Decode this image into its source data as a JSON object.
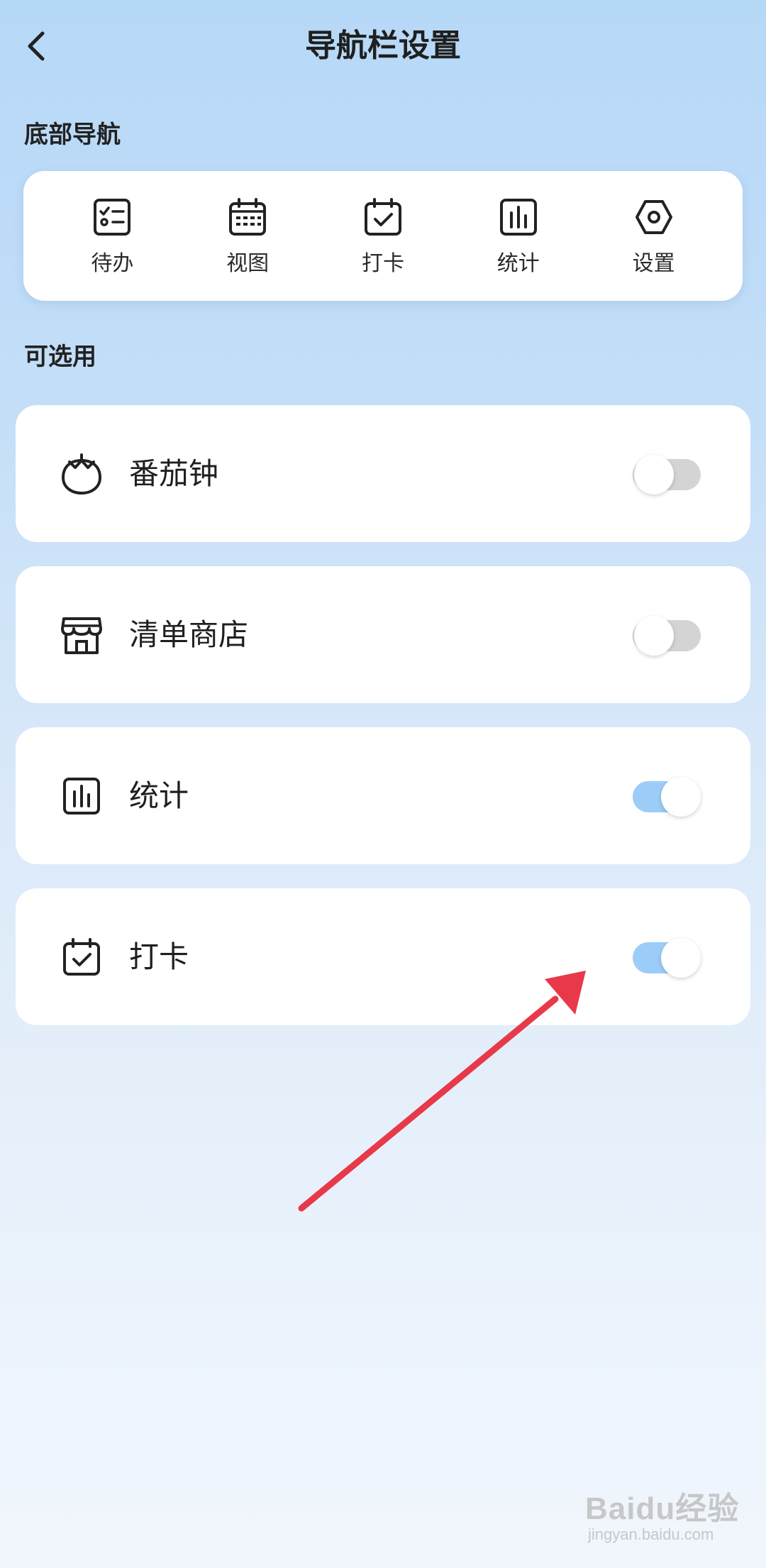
{
  "header": {
    "title": "导航栏设置",
    "back_icon": "chevron-left-icon"
  },
  "bottom_nav": {
    "section_label": "底部导航",
    "items": [
      {
        "label": "待办",
        "icon": "checklist-icon"
      },
      {
        "label": "视图",
        "icon": "calendar-grid-icon"
      },
      {
        "label": "打卡",
        "icon": "calendar-check-icon"
      },
      {
        "label": "统计",
        "icon": "bar-chart-icon"
      },
      {
        "label": "设置",
        "icon": "hexagon-gear-icon"
      }
    ]
  },
  "optional": {
    "section_label": "可选用",
    "items": [
      {
        "label": "番茄钟",
        "icon": "tomato-icon",
        "enabled": false
      },
      {
        "label": "清单商店",
        "icon": "store-icon",
        "enabled": false
      },
      {
        "label": "统计",
        "icon": "bar-chart-icon",
        "enabled": true
      },
      {
        "label": "打卡",
        "icon": "calendar-check-icon",
        "enabled": true
      }
    ]
  },
  "colors": {
    "toggle_on": "#9ccdf8",
    "toggle_off": "#d4d4d4",
    "annotation_arrow": "#e8394a"
  },
  "watermark": {
    "brand": "Baidu经验",
    "sub": "jingyan.baidu.com"
  }
}
